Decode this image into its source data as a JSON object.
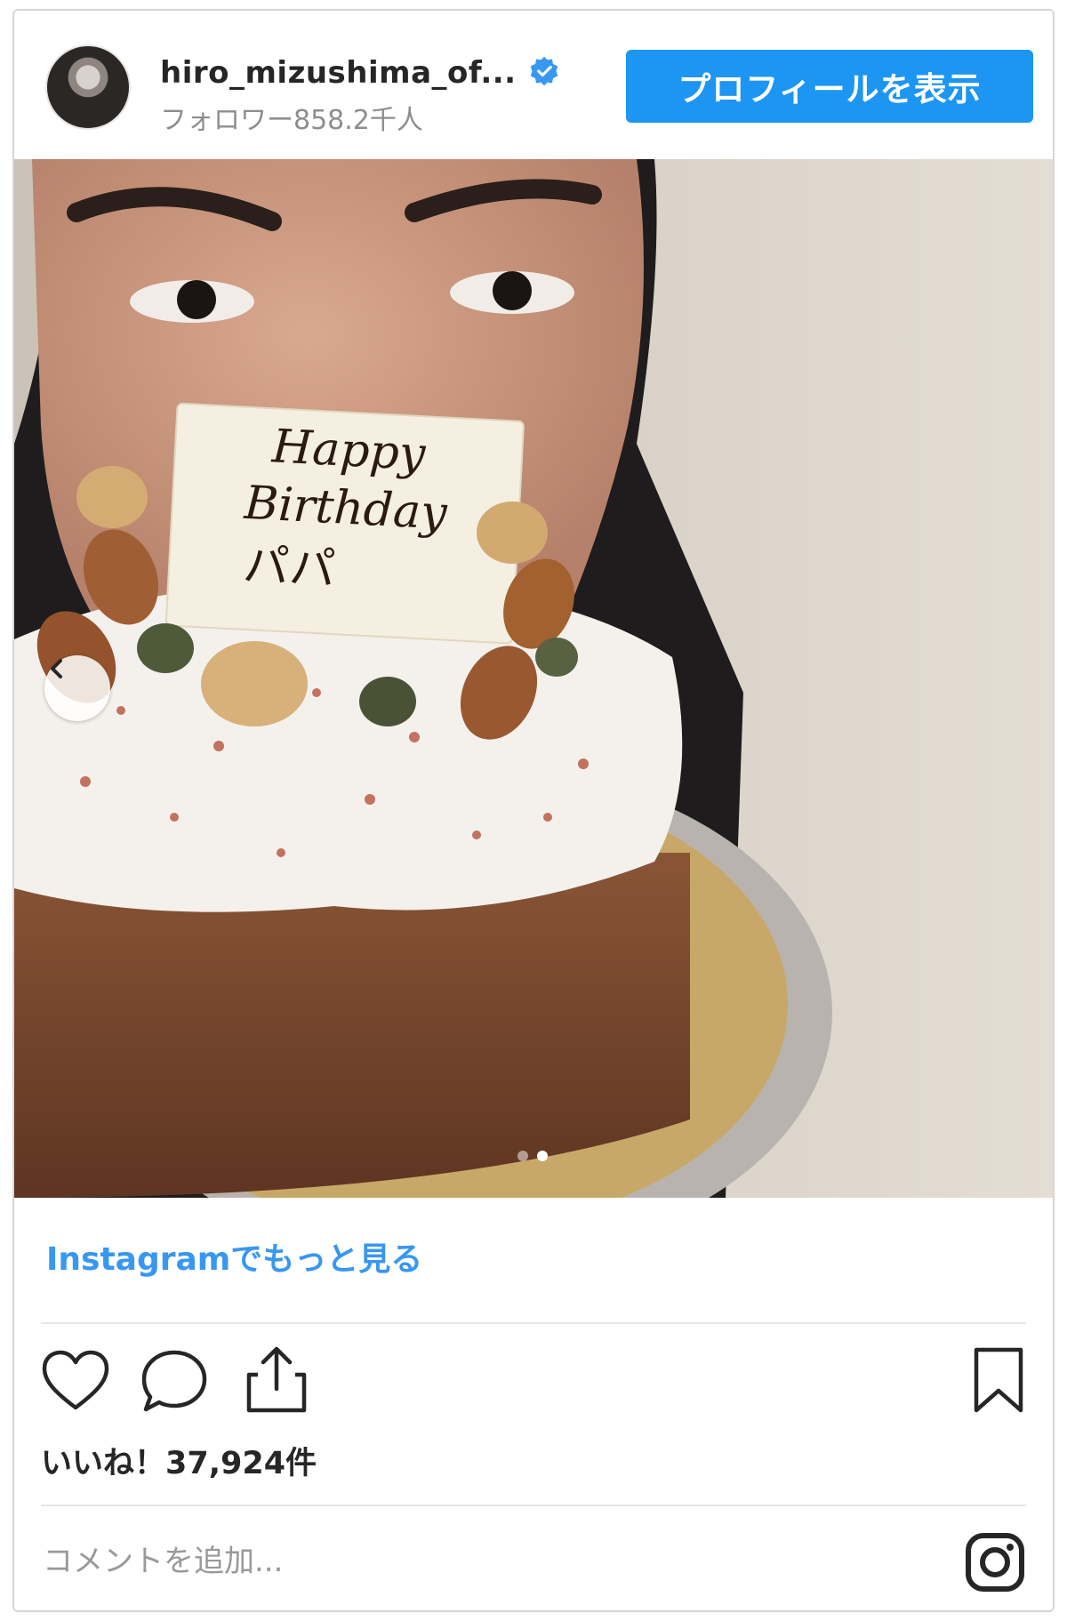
{
  "header": {
    "username": "hiro_mizushima_of...",
    "followers": "フォロワー858.2千人",
    "profile_button": "プロフィールを表示"
  },
  "photo": {
    "plaque_lines": [
      "Happy",
      "Birthday",
      "パパ"
    ],
    "carousel_total": 2,
    "carousel_current": 2
  },
  "more_link": "Instagramでもっと見る",
  "likes": "いいね！37,924件",
  "comment": {
    "placeholder": "コメントを追加..."
  },
  "icons": {
    "verified": "verified-badge-icon",
    "prev": "chevron-left-icon",
    "like": "heart-icon",
    "comment": "comment-bubble-icon",
    "share": "share-icon",
    "save": "bookmark-icon",
    "instagram": "instagram-logo-icon"
  },
  "colors": {
    "accent": "#1d95f2",
    "link": "#3897f0",
    "text": "#262626",
    "muted": "#8e8e8e"
  }
}
